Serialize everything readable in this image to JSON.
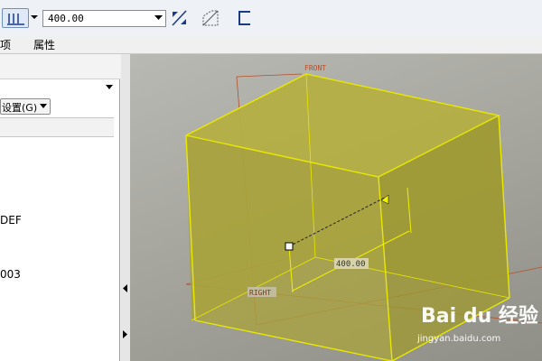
{
  "toolbar": {
    "depth_value": "400.00"
  },
  "menu": {
    "options_label": "项",
    "properties_label": "属性"
  },
  "left_panel": {
    "settings_label": "设置(G)",
    "item_def": "DEF",
    "item_003": "003"
  },
  "viewport": {
    "front_label": "FRONT",
    "right_label": "RIGHT",
    "dimension_label": "400.00",
    "sketch_color": "#d8d800",
    "datum_color": "#b4502a"
  },
  "watermark": {
    "logo": "Bai du 经验",
    "url": "jingyan.baidu.com"
  }
}
